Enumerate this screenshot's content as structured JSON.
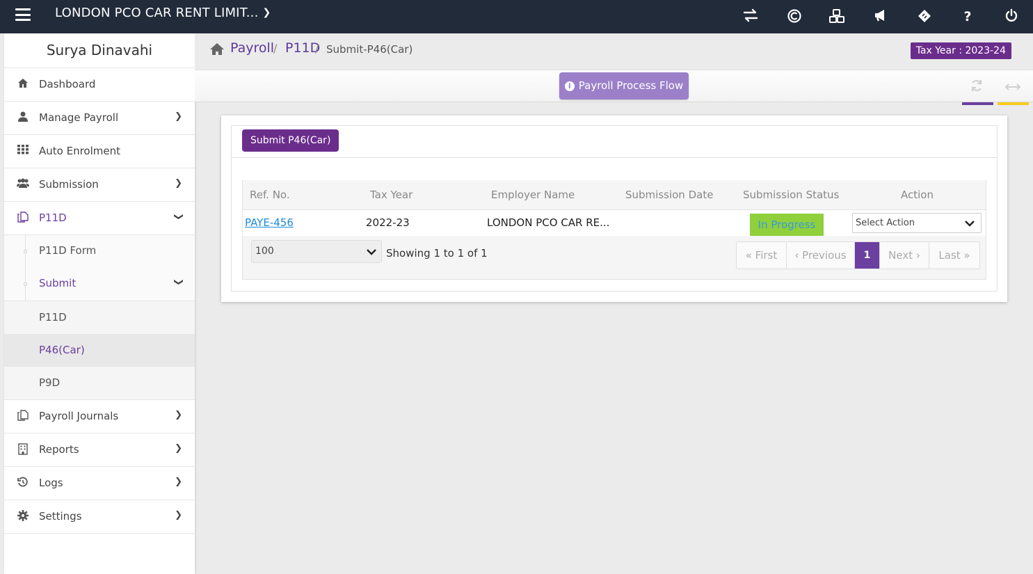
{
  "topbar": {
    "company": "LONDON PCO CAR RENT LIMIT...",
    "icons": [
      "switch-icon",
      "copyright-icon",
      "cubes-icon",
      "megaphone-icon",
      "ticket-icon",
      "help-icon",
      "power-icon"
    ],
    "help_glyph": "?"
  },
  "sidebar": {
    "user": "Surya Dinavahi",
    "items": [
      {
        "label": "Dashboard",
        "icon": "home-icon"
      },
      {
        "label": "Manage Payroll",
        "icon": "user-icon"
      },
      {
        "label": "Auto Enrolment",
        "icon": "grid-icon"
      },
      {
        "label": "Submission",
        "icon": "users-icon"
      },
      {
        "label": "P11D",
        "icon": "copy-icon"
      },
      {
        "label": "Payroll Journals",
        "icon": "copy-icon"
      },
      {
        "label": "Reports",
        "icon": "building-icon"
      },
      {
        "label": "Logs",
        "icon": "history-icon"
      },
      {
        "label": "Settings",
        "icon": "gear-icon"
      }
    ],
    "p11d_sub": [
      {
        "label": "P11D Form"
      },
      {
        "label": "Submit"
      }
    ],
    "submit_sub": [
      {
        "label": "P11D"
      },
      {
        "label": "P46(Car)"
      },
      {
        "label": "P9D"
      }
    ]
  },
  "breadcrumb": {
    "home": "Payroll",
    "level2": "P11D",
    "current": "Submit-P46(Car)",
    "separator": "/"
  },
  "tax_year_badge": "Tax Year : 2023-24",
  "toolbar": {
    "flow_button": "Payroll Process Flow"
  },
  "panel": {
    "submit_button": "Submit P46(Car)",
    "columns": [
      "Ref. No.",
      "Tax Year",
      "Employer Name",
      "Submission Date",
      "Submission Status",
      "Action"
    ],
    "rows": [
      {
        "ref": "PAYE-456",
        "tax_year": "2022-23",
        "employer": "LONDON PCO CAR RE...",
        "submission_date": "",
        "status": "In Progress",
        "action_placeholder": "Select Action"
      }
    ],
    "page_size": "100",
    "showing": "Showing 1 to 1 of 1",
    "pager": {
      "first": "« First",
      "previous": "‹ Previous",
      "current": "1",
      "next": "Next ›",
      "last": "Last »"
    }
  },
  "colors": {
    "topbar": "#222b3a",
    "accent": "#6b3fa0",
    "badge": "#6b2d8c",
    "status_bg": "#8fd03c",
    "link": "#1a8cd8"
  }
}
